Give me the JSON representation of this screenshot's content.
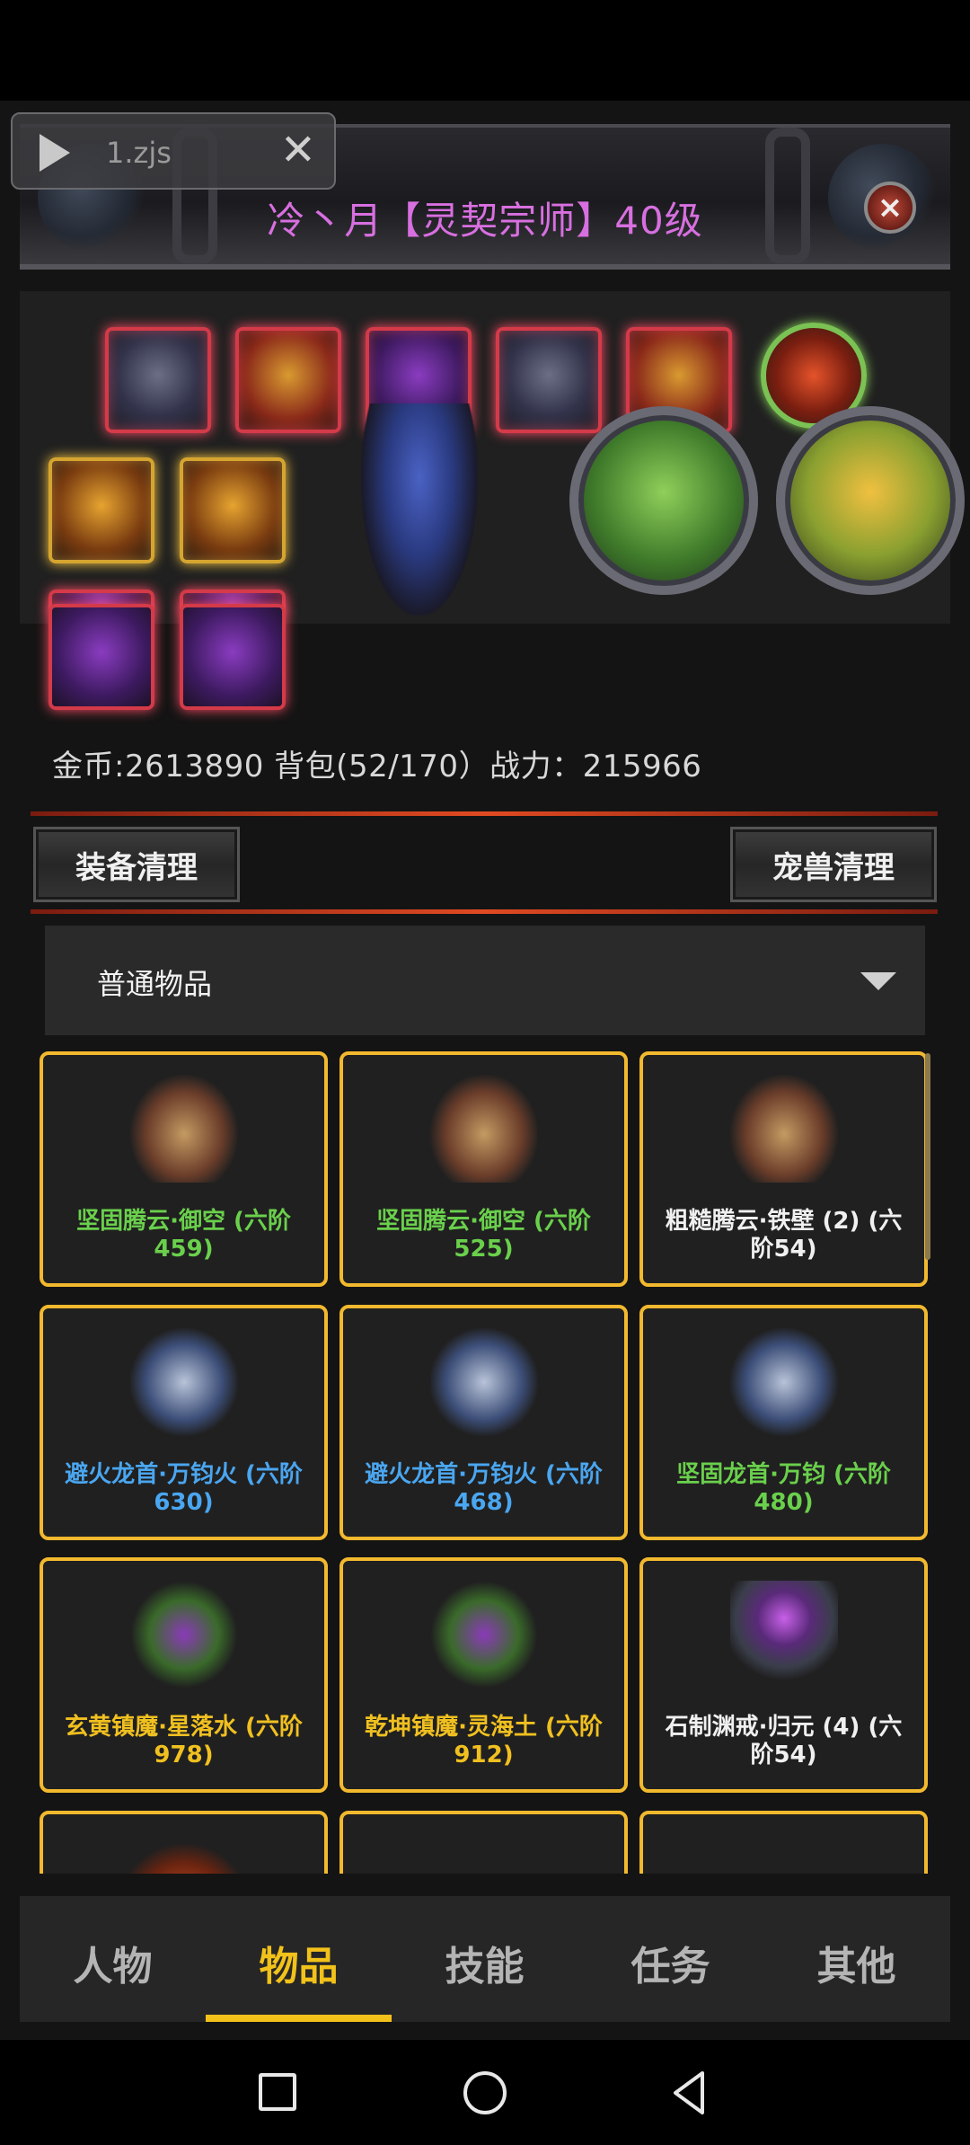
{
  "title_banner": {
    "title": "冷丶月【灵契宗师】40级",
    "close_icon": "close-circle-icon"
  },
  "script_chip": {
    "name": "1.zjs",
    "play_icon": "play-icon",
    "close_icon": "close-x-icon"
  },
  "character": {
    "equipment_icons": [
      "helmet-icon",
      "armor-icon",
      "amulet-icon",
      "wings-icon",
      "armor-icon",
      "ring-icon",
      "scepter-icon",
      "scepter-icon",
      "orb-icon",
      "orb-icon"
    ],
    "stats_text": "金币:2613890 背包(52/170）战力：215966"
  },
  "buttons": {
    "equip_clean": "装备清理",
    "pet_clean": "宠兽清理"
  },
  "filter": {
    "selected": "普通物品"
  },
  "items": [
    {
      "name": "坚固腾云·御空 (六阶459)",
      "color": "#6ad04c"
    },
    {
      "name": "坚固腾云·御空 (六阶525)",
      "color": "#6ad04c"
    },
    {
      "name": "粗糙腾云·铁壁 (2) (六阶54)",
      "color": "#f0f0f0"
    },
    {
      "name": "避火龙首·万钧火 (六阶630)",
      "color": "#4aa6f0"
    },
    {
      "name": "避火龙首·万钧火 (六阶468)",
      "color": "#4aa6f0"
    },
    {
      "name": "坚固龙首·万钧 (六阶480)",
      "color": "#6ad04c"
    },
    {
      "name": "玄黄镇魔·星落水 (六阶978)",
      "color": "#f0c020"
    },
    {
      "name": "乾坤镇魔·灵海土 (六阶912)",
      "color": "#f0c020"
    },
    {
      "name": "石制渊戒·归元 (4) (六阶54)",
      "color": "#f0f0f0"
    }
  ],
  "tabs": [
    "人物",
    "物品",
    "技能",
    "任务",
    "其他"
  ],
  "active_tab": "物品",
  "accent": "#f2c21a"
}
